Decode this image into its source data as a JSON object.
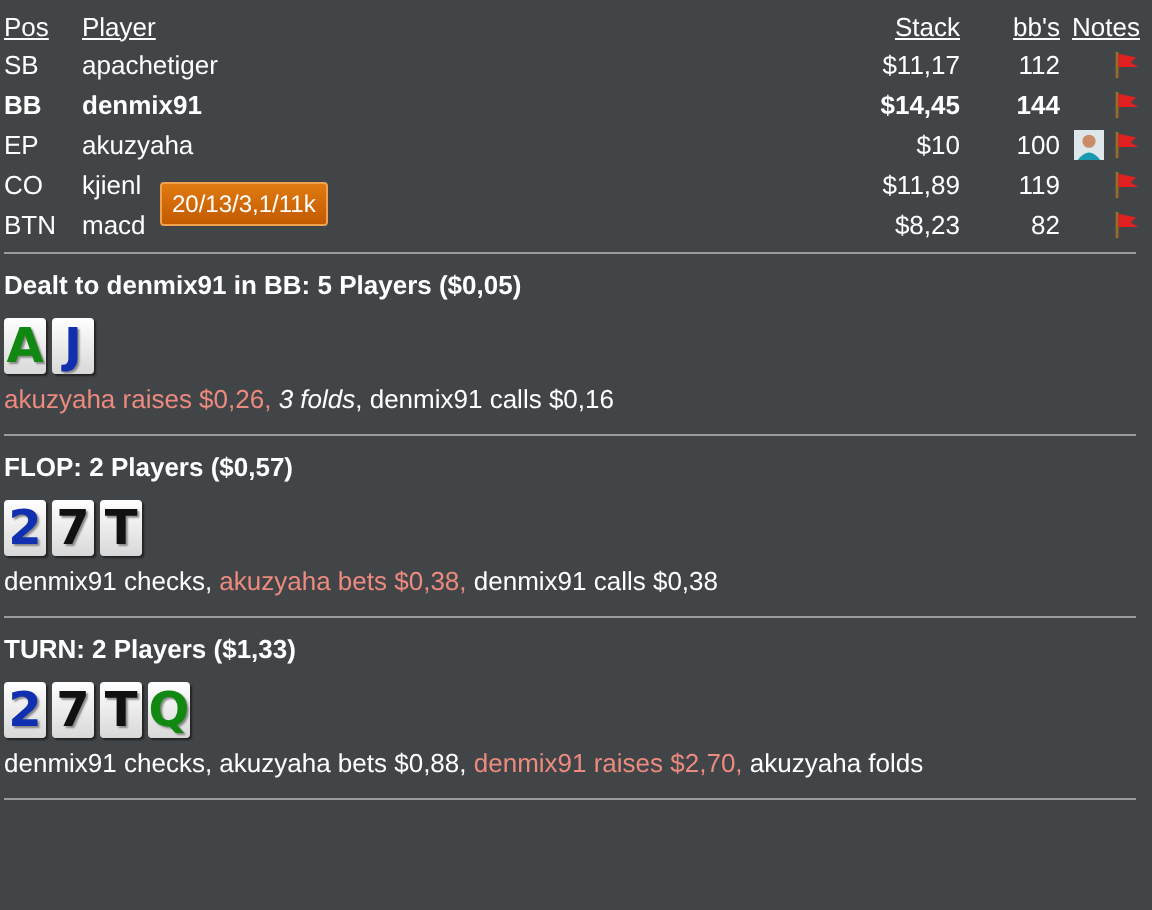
{
  "columns": [
    "Pos",
    "Player",
    "Stack",
    "bb's",
    "Notes"
  ],
  "players": [
    {
      "pos": "SB",
      "name": "apachetiger",
      "stack": "$11,17",
      "bbs": "112",
      "hero": false,
      "has_note": false
    },
    {
      "pos": "BB",
      "name": "denmix91",
      "stack": "$14,45",
      "bbs": "144",
      "hero": true,
      "has_note": false
    },
    {
      "pos": "EP",
      "name": "akuzyaha",
      "stack": "$10",
      "bbs": "100",
      "hero": false,
      "has_note": true
    },
    {
      "pos": "CO",
      "name": "kjienl",
      "stack": "$11,89",
      "bbs": "119",
      "hero": false,
      "has_note": false
    },
    {
      "pos": "BTN",
      "name": "macd",
      "stack": "$8,23",
      "bbs": "82",
      "hero": false,
      "has_note": false
    }
  ],
  "tooltip": "20/13/3,1/11k",
  "streets": [
    {
      "title": "Dealt to denmix91 in BB: 5 Players ($0,05)",
      "cards": [
        {
          "rank": "A",
          "color": "#118811"
        },
        {
          "rank": "J",
          "color": "#1030b0"
        }
      ],
      "actions": [
        {
          "text": "akuzyaha raises $0,26, ",
          "kind": "aggressive"
        },
        {
          "text": "3 folds",
          "kind": "summary"
        },
        {
          "text": ", denmix91 calls $0,16",
          "kind": "plain"
        }
      ]
    },
    {
      "title": "FLOP: 2 Players ($0,57)",
      "cards": [
        {
          "rank": "2",
          "color": "#1030b0"
        },
        {
          "rank": "7",
          "color": "#111111"
        },
        {
          "rank": "T",
          "color": "#111111"
        }
      ],
      "actions": [
        {
          "text": "denmix91 checks, ",
          "kind": "plain"
        },
        {
          "text": "akuzyaha bets $0,38, ",
          "kind": "aggressive"
        },
        {
          "text": "denmix91 calls $0,38",
          "kind": "plain"
        }
      ]
    },
    {
      "title": "TURN: 2 Players ($1,33)",
      "cards": [
        {
          "rank": "2",
          "color": "#1030b0"
        },
        {
          "rank": "7",
          "color": "#111111"
        },
        {
          "rank": "T",
          "color": "#111111"
        },
        {
          "rank": "Q",
          "color": "#118811"
        }
      ],
      "actions": [
        {
          "text": "denmix91 checks, akuzyaha bets $0,88, ",
          "kind": "plain"
        },
        {
          "text": "denmix91 raises $2,70, ",
          "kind": "aggressive"
        },
        {
          "text": "akuzyaha folds",
          "kind": "plain"
        }
      ]
    }
  ]
}
